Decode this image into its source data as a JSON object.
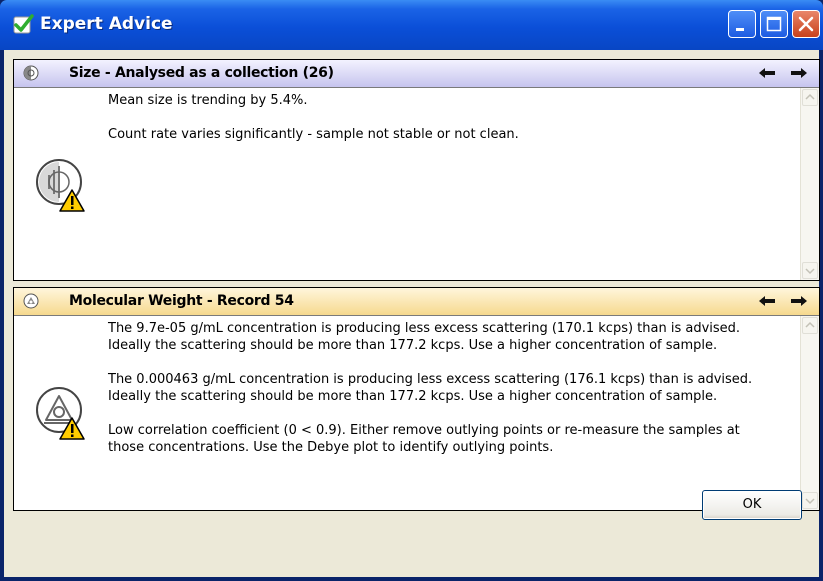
{
  "window": {
    "title": "Expert Advice"
  },
  "panels": [
    {
      "header": "Size - Analysed as a collection (26)",
      "header_icon": "size-measurement-icon",
      "body_icon": "size-warning-icon",
      "messages": [
        "Mean size is trending by 5.4%.",
        "Count rate varies significantly - sample not stable or not clean."
      ]
    },
    {
      "header": "Molecular Weight - Record 54",
      "header_icon": "molecular-weight-icon",
      "body_icon": "molecular-weight-warning-icon",
      "messages": [
        "The 9.7e-05 g/mL concentration is producing less excess scattering (170.1 kcps) than is advised.\nIdeally the scattering should be more than 177.2 kcps.  Use a higher concentration of sample.",
        "The 0.000463 g/mL concentration is producing less excess scattering (176.1 kcps) than is advised.\nIdeally the scattering should be more than 177.2 kcps.  Use a higher concentration of sample.",
        "Low correlation coefficient (0 < 0.9).  Either remove outlying points or re-measure the samples at\nthose concentrations.  Use the Debye plot to identify outlying points."
      ]
    }
  ],
  "buttons": {
    "ok": "OK"
  },
  "colors": {
    "titlebar": "#0b4fd8",
    "panel1_header": "#c6c4ee",
    "panel2_header": "#f6d98e",
    "dialog_bg": "#ece9d8"
  }
}
